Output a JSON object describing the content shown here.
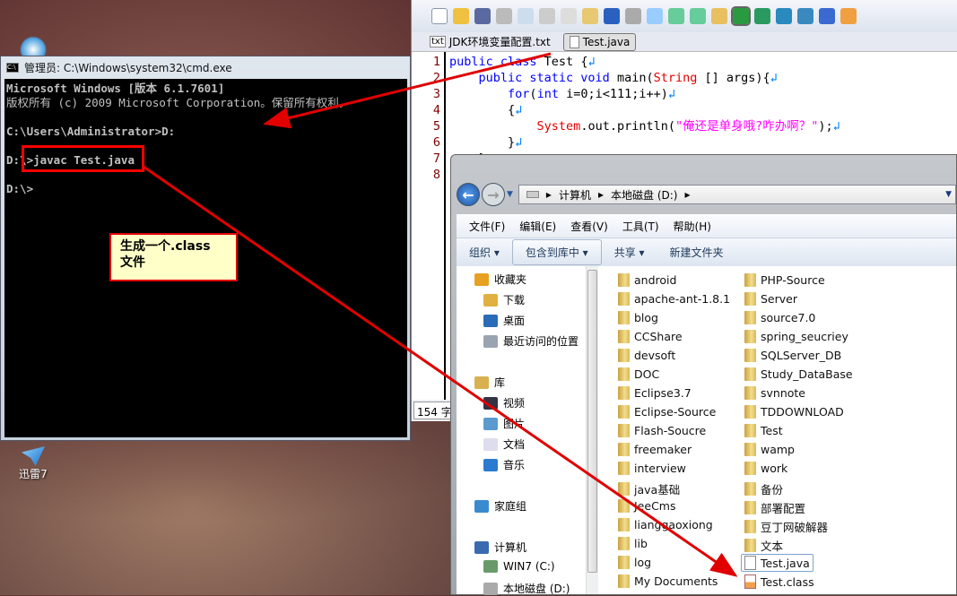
{
  "desktop": {
    "icons": [
      {
        "label": "迅雷7"
      }
    ]
  },
  "cmd": {
    "title": "管理员: C:\\Windows\\system32\\cmd.exe",
    "lines": [
      "Microsoft Windows [版本 6.1.7601]",
      "版权所有 (c) 2009 Microsoft Corporation。保留所有权利。",
      "",
      "C:\\Users\\Administrator>D:",
      "",
      "D:\\>javac Test.java",
      "",
      "D:\\>"
    ]
  },
  "callout": {
    "text": "生成一个.class\n文件"
  },
  "editor": {
    "tabs": [
      {
        "label": "JDK环境变量配置.txt",
        "icon": "txt"
      },
      {
        "label": "Test.java",
        "active": true
      }
    ],
    "line_numbers": [
      "1",
      "2",
      "3",
      "4",
      "5",
      "6",
      "7",
      "8"
    ],
    "code": {
      "l1_kw": "public class",
      "l1_rest": " Test {",
      "l2_kw1": "public static void",
      "l2_a": " main(",
      "l2_cls": "String",
      "l2_b": " [] args){",
      "l3_kw": "for",
      "l3_a": "(",
      "l3_kw2": "int",
      "l3_b": " i=0;i<111;i++)",
      "l4": "{",
      "l5_cls": "System",
      "l5_a": ".out.println(",
      "l5_str": "\"俺还是单身哦?咋办啊？\"",
      "l5_b": ");",
      "l6": "}",
      "l7": "}",
      "ret": "↲"
    },
    "status": "154 字"
  },
  "explorer": {
    "breadcrumb": [
      "计算机",
      "本地磁盘 (D:)"
    ],
    "menu": [
      "文件(F)",
      "编辑(E)",
      "查看(V)",
      "工具(T)",
      "帮助(H)"
    ],
    "commands": [
      {
        "label": "组织 ▾"
      },
      {
        "label": "包含到库中 ▾"
      },
      {
        "label": "共享 ▾"
      },
      {
        "label": "新建文件夹"
      }
    ],
    "nav": [
      {
        "label": "收藏夹",
        "icon": "star-icon",
        "color": "#e8a020",
        "indent": 0
      },
      {
        "label": "下载",
        "icon": "download-icon",
        "color": "#e0b040",
        "indent": 1
      },
      {
        "label": "桌面",
        "icon": "desktop-icon",
        "color": "#2a6cb8",
        "indent": 1
      },
      {
        "label": "最近访问的位置",
        "icon": "recent-places-icon",
        "color": "#9aa4b0",
        "indent": 1
      },
      {
        "label": "库",
        "icon": "library-icon",
        "color": "#d8b050",
        "indent": 0
      },
      {
        "label": "视频",
        "icon": "video-icon",
        "color": "#334",
        "indent": 1
      },
      {
        "label": "图片",
        "icon": "pictures-icon",
        "color": "#5a9ad0",
        "indent": 1
      },
      {
        "label": "文档",
        "icon": "documents-icon",
        "color": "#dde",
        "indent": 1
      },
      {
        "label": "音乐",
        "icon": "music-icon",
        "color": "#2a7ad0",
        "indent": 1
      },
      {
        "label": "家庭组",
        "icon": "homegroup-icon",
        "color": "#3a8ad0",
        "indent": 0
      },
      {
        "label": "计算机",
        "icon": "computer-icon",
        "color": "#3a6ab0",
        "indent": 0
      },
      {
        "label": "WIN7 (C:)",
        "icon": "drive-c-icon",
        "color": "#6a9a6a",
        "indent": 1
      },
      {
        "label": "本地磁盘 (D:)",
        "icon": "drive-d-icon",
        "color": "#aaa",
        "indent": 1
      }
    ],
    "files_col1": [
      "android",
      "apache-ant-1.8.1",
      "blog",
      "CCShare",
      "devsoft",
      "DOC",
      "Eclipse3.7",
      "Eclipse-Source",
      "Flash-Soucre",
      "freemaker",
      "interview",
      "java基础",
      "JeeCms",
      "lianggaoxiong",
      "lib",
      "log",
      "My Documents"
    ],
    "files_col2": [
      {
        "name": "PHP-Source",
        "type": "folder"
      },
      {
        "name": "Server",
        "type": "folder"
      },
      {
        "name": "source7.0",
        "type": "folder"
      },
      {
        "name": "spring_seucriey",
        "type": "folder"
      },
      {
        "name": "SQLServer_DB",
        "type": "folder"
      },
      {
        "name": "Study_DataBase",
        "type": "folder"
      },
      {
        "name": "svnnote",
        "type": "folder"
      },
      {
        "name": "TDDOWNLOAD",
        "type": "folder"
      },
      {
        "name": "Test",
        "type": "folder"
      },
      {
        "name": "wamp",
        "type": "folder"
      },
      {
        "name": "work",
        "type": "folder"
      },
      {
        "name": "备份",
        "type": "folder"
      },
      {
        "name": "部署配置",
        "type": "folder"
      },
      {
        "name": "豆丁网破解器",
        "type": "folder"
      },
      {
        "name": "文本",
        "type": "folder"
      },
      {
        "name": "Test.java",
        "type": "file",
        "selected": true
      },
      {
        "name": "Test.class",
        "type": "class"
      }
    ]
  },
  "colors": {
    "annotation": "#e00000",
    "keyword": "#0000ff",
    "string": "#ff00ff"
  }
}
